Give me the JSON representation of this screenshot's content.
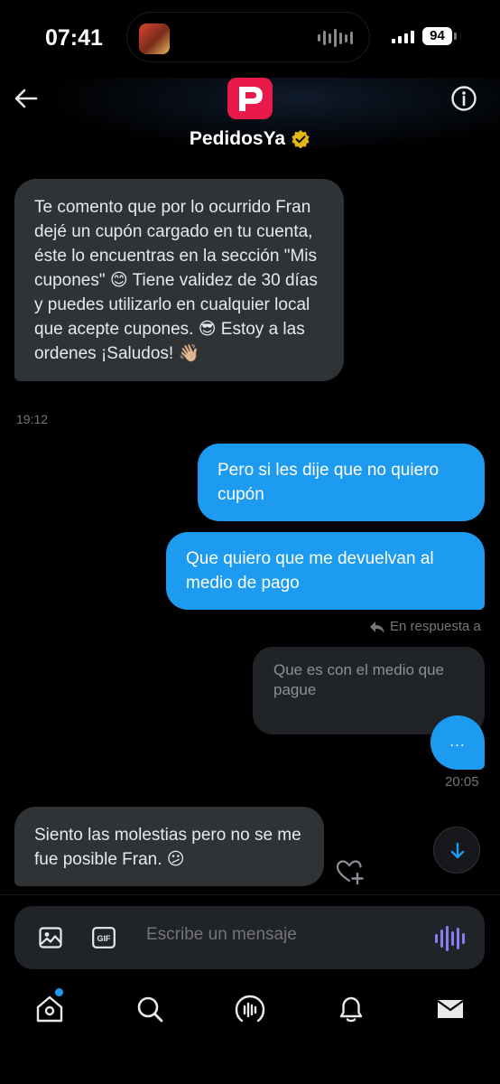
{
  "status_bar": {
    "time": "07:41",
    "battery": "94"
  },
  "header": {
    "contact_name": "PedidosYa",
    "verified": true,
    "brand_color": "#e8194b"
  },
  "messages": [
    {
      "direction": "incoming",
      "text": "Te comento que por lo ocurrido Fran dejé un cupón cargado en tu cuenta, éste lo encuentras en la sección \"Mis cupones\" 😊 Tiene validez de 30 días y puedes utilizarlo en cualquier local que acepte cupones. 😎 Estoy a las ordenes ¡Saludos! 👋🏼",
      "time": "19:12"
    },
    {
      "direction": "outgoing",
      "text": "Pero si les dije que no quiero cupón"
    },
    {
      "direction": "outgoing",
      "text": "Que quiero que me devuelvan al medio de pago"
    },
    {
      "direction": "outgoing",
      "reply_label": "En respuesta a",
      "quoted_text": "Que es con el medio que pague",
      "text": "...",
      "time": "20:05"
    },
    {
      "direction": "incoming",
      "text": "Siento las molestias pero no se me fue posible Fran. 😕"
    }
  ],
  "composer": {
    "placeholder": "Escribe un mensaje",
    "gif_label": "GIF"
  },
  "tabs": [
    {
      "icon": "home-icon",
      "has_notification": true
    },
    {
      "icon": "search-icon"
    },
    {
      "icon": "spaces-icon"
    },
    {
      "icon": "bell-icon"
    },
    {
      "icon": "mail-icon"
    }
  ],
  "colors": {
    "accent": "#1d9bf0",
    "incoming_bubble": "#2f3336",
    "verified_gold": "#e2b719",
    "voice_purple": "#8b7bf3"
  }
}
